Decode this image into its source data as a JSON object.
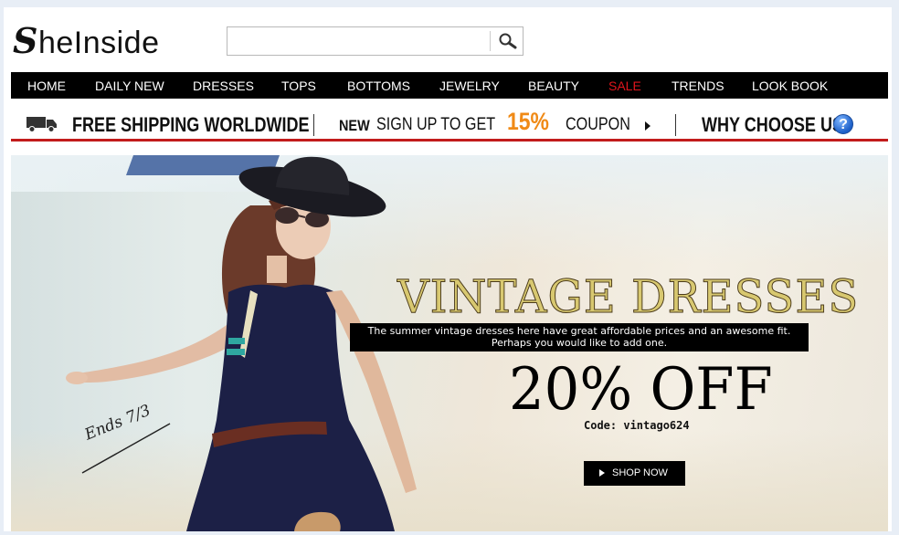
{
  "header": {
    "logo_initial": "S",
    "logo_rest": "heInside",
    "search": {
      "value": "",
      "placeholder": ""
    }
  },
  "nav": {
    "items": [
      {
        "label": "HOME"
      },
      {
        "label": "DAILY NEW"
      },
      {
        "label": "DRESSES"
      },
      {
        "label": "TOPS"
      },
      {
        "label": "BOTTOMS"
      },
      {
        "label": "JEWELRY"
      },
      {
        "label": "BEAUTY"
      },
      {
        "label": "SALE"
      },
      {
        "label": "TRENDS"
      },
      {
        "label": "LOOK BOOK"
      }
    ],
    "sale_color": "#e0151c"
  },
  "promo": {
    "free_shipping": "FREE SHIPPING WORLDWIDE",
    "new_label": "NEW",
    "signup_text": "SIGN UP TO GET",
    "percent": "15%",
    "coupon": "COUPON",
    "why_choose": "WHY CHOOSE US",
    "help_icon": "?",
    "accent_color": "#f08a16",
    "line_color": "#c21c1c"
  },
  "banner": {
    "title": "VINTAGE DRESSES",
    "description_line1": "The summer vintage dresses here have great affordable prices and an awesome fit.",
    "description_line2": "Perhaps  you would like to add one.",
    "discount": "20% OFF",
    "code": "Code: vintago624",
    "shop_button": "SHOP NOW",
    "ends": "Ends 7/3"
  }
}
